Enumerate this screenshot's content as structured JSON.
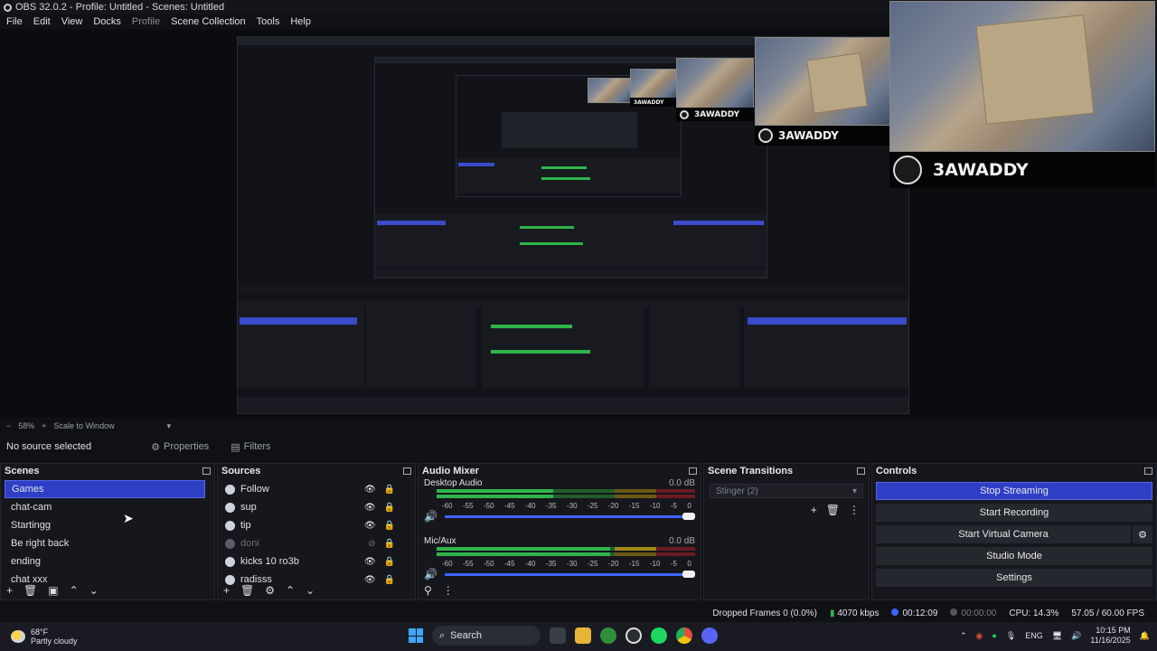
{
  "window": {
    "title": "OBS 32.0.2 - Profile: Untitled - Scenes: Untitled"
  },
  "menu": [
    "File",
    "Edit",
    "View",
    "Docks",
    "Profile",
    "Scene Collection",
    "Tools",
    "Help"
  ],
  "overlay": {
    "cam_name": "3AWADDY"
  },
  "zoom": {
    "minus": "−",
    "percent": "58%",
    "plus": "+",
    "mode": "Scale to Window"
  },
  "source_bar": {
    "status": "No source selected",
    "properties": "Properties",
    "filters": "Filters"
  },
  "scenes": {
    "title": "Scenes",
    "items": [
      "Games",
      "chat-cam",
      "Startingg",
      "Be right back",
      "ending",
      "chat xxx"
    ],
    "selected": 0
  },
  "sources": {
    "title": "Sources",
    "items": [
      {
        "name": "Follow",
        "visible": true
      },
      {
        "name": "sup",
        "visible": true
      },
      {
        "name": "tip",
        "visible": true
      },
      {
        "name": "doni",
        "visible": false
      },
      {
        "name": "kicks 10 ro3b",
        "visible": true
      },
      {
        "name": "radisss",
        "visible": true
      }
    ]
  },
  "mixer": {
    "title": "Audio Mixer",
    "channels": [
      {
        "name": "Desktop Audio",
        "db": "0.0 dB",
        "level": 0.45
      },
      {
        "name": "Mic/Aux",
        "db": "0.0 dB",
        "level": 0.67
      }
    ],
    "ticks": [
      "-60",
      "-55",
      "-50",
      "-45",
      "-40",
      "-35",
      "-30",
      "-25",
      "-20",
      "-15",
      "-10",
      "-5",
      "0"
    ]
  },
  "transitions": {
    "title": "Scene Transitions",
    "selected": "Stinger (2)"
  },
  "controls": {
    "title": "Controls",
    "stop_streaming": "Stop Streaming",
    "start_recording": "Start Recording",
    "start_virtual_camera": "Start Virtual Camera",
    "studio_mode": "Studio Mode",
    "settings": "Settings"
  },
  "status": {
    "dropped_frames": "Dropped Frames 0 (0.0%)",
    "bitrate": "4070 kbps",
    "stream_time": "00:12:09",
    "record_time": "00:00:00",
    "cpu": "CPU: 14.3%",
    "fps": "57.05 / 60.00 FPS"
  },
  "taskbar": {
    "temp": "68°F",
    "weather": "Partly cloudy",
    "search": "Search",
    "lang": "ENG",
    "time": "10:15 PM",
    "date": "11/16/2025"
  },
  "colors": {
    "accent": "#2e3fc6",
    "meter_green": "#2fb44a",
    "meter_yellow": "#a08a1a",
    "meter_red": "#8a1f2a"
  }
}
